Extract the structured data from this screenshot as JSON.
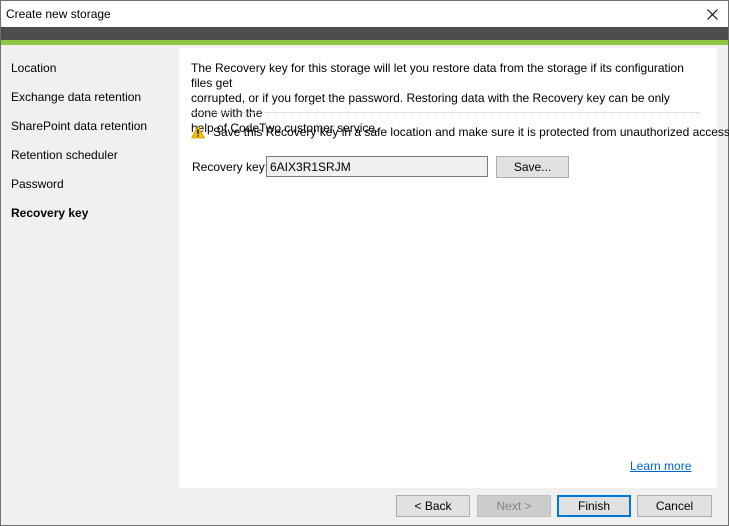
{
  "window": {
    "title": "Create new storage"
  },
  "colors": {
    "header_band": "#4d4d4d",
    "accent_green": "#8dc63f",
    "link": "#0066cc",
    "focus": "#0078d7"
  },
  "sidebar": {
    "items": [
      {
        "label": "Location",
        "active": false
      },
      {
        "label": "Exchange data retention",
        "active": false
      },
      {
        "label": "SharePoint data retention",
        "active": false
      },
      {
        "label": "Retention scheduler",
        "active": false
      },
      {
        "label": "Password",
        "active": false
      },
      {
        "label": "Recovery key",
        "active": true
      }
    ]
  },
  "content": {
    "description_line1": "The Recovery key for this storage will let you restore data from the storage if its configuration files get",
    "description_line2": "corrupted, or if you forget the password. Restoring data with the Recovery key can be only done with the",
    "description_line3": "help of CodeTwo customer service.",
    "warning_icon": "warning-triangle-icon",
    "warning_text": "Save this Recovery key in a safe location and make sure it is protected from unauthorized access.",
    "recovery_key_label": "Recovery key:",
    "recovery_key_value": "6AIX3R1SRJM",
    "save_button_label": "Save...",
    "learn_more_label": "Learn more"
  },
  "footer": {
    "back_label": "< Back",
    "next_label": "Next >",
    "finish_label": "Finish",
    "cancel_label": "Cancel"
  }
}
